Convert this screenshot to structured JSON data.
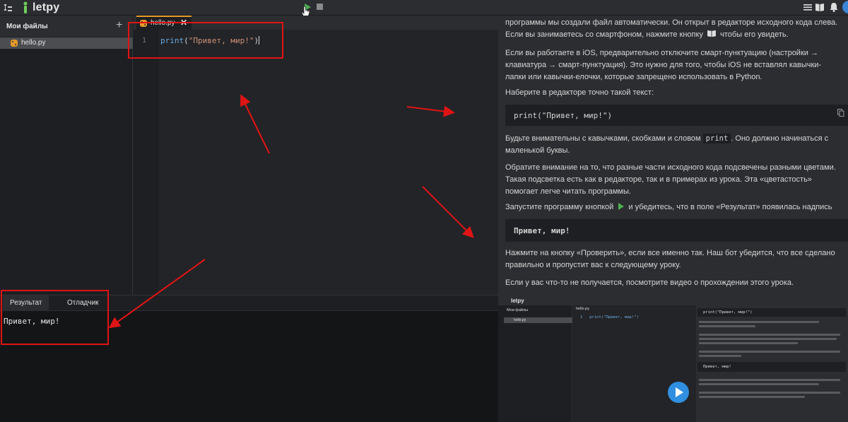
{
  "app": {
    "name": "letpy"
  },
  "colors": {
    "accent": "#e69a2a",
    "run": "#4caf50",
    "annotation": "#e01414",
    "play": "#2f8fe0"
  },
  "sidebar": {
    "title": "Мои файлы",
    "add_label": "+",
    "files": [
      {
        "name": "hello.py"
      }
    ]
  },
  "editor": {
    "tab": {
      "label": "hello.py",
      "close": "✕"
    },
    "line_number": "1",
    "code": {
      "fn": "print",
      "open": "(",
      "str": "\"Привет, мир!\"",
      "close": ")"
    }
  },
  "bottom": {
    "tabs": [
      "Результат",
      "Отладчик"
    ],
    "output": "Привет, мир!"
  },
  "lesson": {
    "p1": "программы мы создали файл автоматически. Он открыт в редакторе исходного кода слева. Если вы занимаетесь со смартфоном, нажмите кнопку",
    "p1_end": "чтобы его увидеть.",
    "p2": "Если вы работаете в iOS, предварительно отключите смарт-пунктуацию (настройки → клавиатура → смарт-пунктуация). Это нужно для того, чтобы iOS не вставлял кавычки-лапки или кавычки-елочки, которые запрещено использовать в Python.",
    "p3": "Наберите в редакторе точно такой текст:",
    "code_block": "print(\"Привет, мир!\")",
    "p4_a": "Будьте внимательны с кавычками, скобками и словом",
    "p4_code": "print",
    "p4_b": ". Оно должно начинаться с маленькой буквы.",
    "p5": "Обратите внимание на то, что разные части исходного кода подсвечены разными цветами. Такая подсветка есть как в редакторе, так и в примерах из урока. Эта «цветастость» помогает легче читать программы.",
    "p6_a": "Запустите программу кнопкой",
    "p6_b": "и убедитесь, что в поле «Результат» появилась надпись",
    "output_block": "Привет, мир!",
    "p7": "Нажмите на кнопку «Проверить», если все именно так. Наш бот убедится, что все сделано правильно и пропустит вас к следующему уроку.",
    "p8": "Если у вас что-то не получается, посмотрите видео о прохождении этого урока."
  },
  "video": {
    "logo": "letpy",
    "sidebar_title": "Мои файлы",
    "file": "hello.py",
    "tab": "hello.py",
    "code": "1   print(\"Привет, мир!\")",
    "code_block": "print(\"Привет, мир!\")",
    "output_block": "Привет, мир!"
  }
}
